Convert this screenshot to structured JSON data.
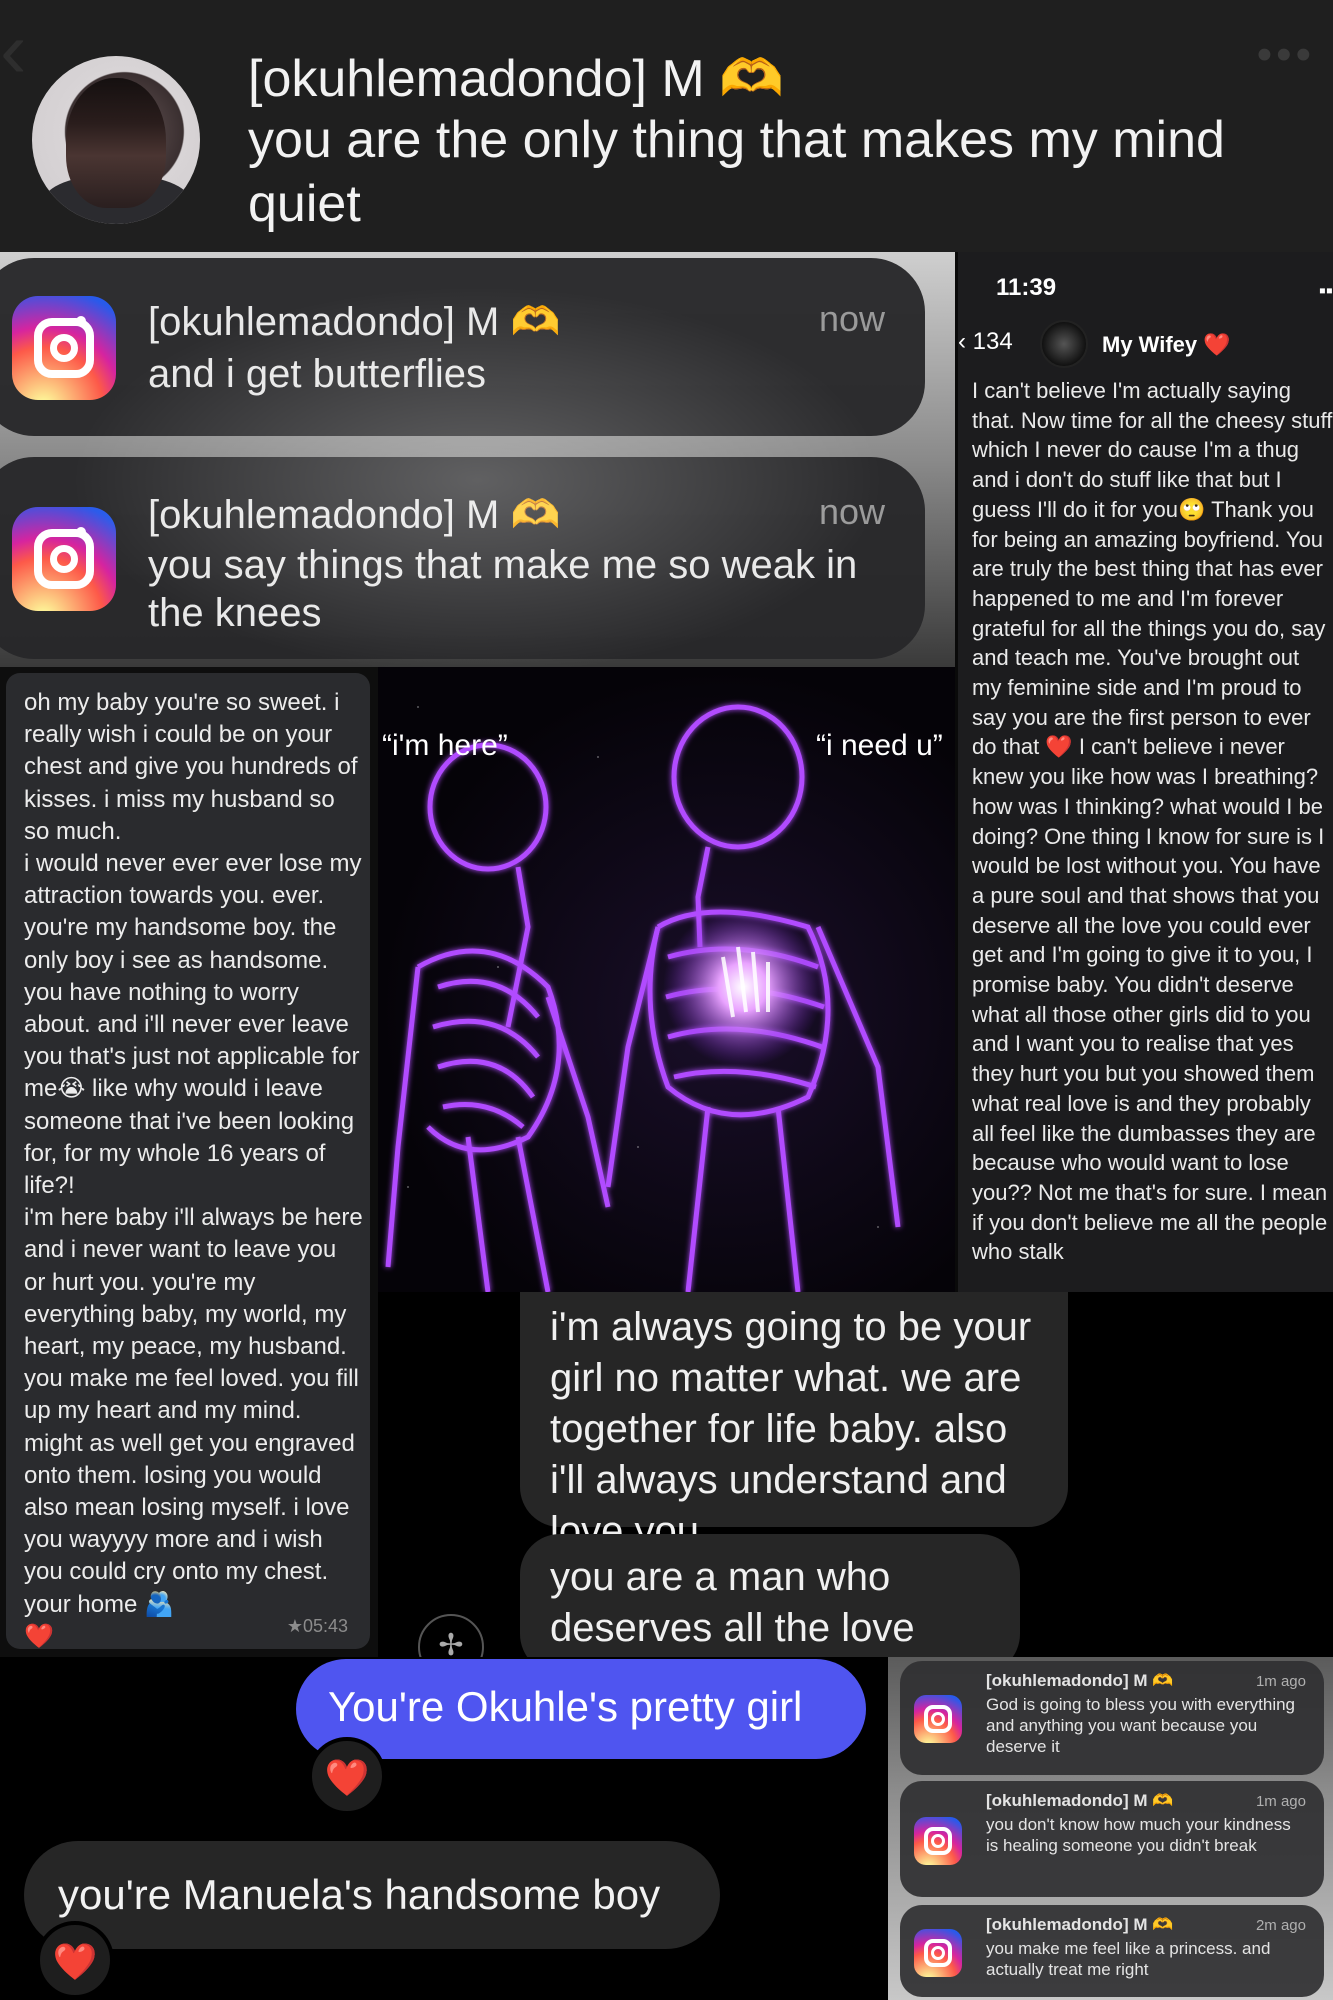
{
  "header": {
    "sender": "[okuhlemadondo] M 🫶",
    "text": "you are the only thing that makes my mind quiet"
  },
  "notifications": [
    {
      "sender": "[okuhlemadondo] M 🫶",
      "time": "now",
      "body": "and i get butterflies"
    },
    {
      "sender": "[okuhlemadondo] M 🫶",
      "time": "now",
      "body": "you say things that make me so weak in the knees"
    }
  ],
  "right_chat": {
    "status_time": "11:39",
    "back_count": "134",
    "contact_name": "My Wifey ❤️",
    "message": "I can't believe I'm actually saying that. Now time for all the cheesy stuff which I never do cause I'm a thug and i don't do stuff like that but I guess I'll do it for you🙄 Thank you for being an amazing boyfriend. You are truly the best thing that has ever happened to me and I'm forever grateful for all the things you do, say and teach me. You've brought out my feminine side and I'm proud to say you are the first person to ever do that ❤️ I can't believe i never knew you like how was I breathing? how was I thinking? what would I be doing? One thing I know for sure is I would be lost without you. You have a pure soul and that shows that you deserve all the love you could ever get and I'm going to give it to you, I promise baby. You didn't deserve what all those other girls did to you and I want you to realise that yes they hurt you but you showed them what real love is and they probably all feel like the dumbasses they are because who would want to lose you?? Not me that's for sure. I mean if you don't believe me all the people who stalk"
  },
  "left_chat": {
    "message": "oh my baby you're so sweet. i really wish i could be on your chest and give you hundreds of kisses. i miss my husband so so much.\ni would never ever ever lose my attraction towards you. ever. you're my handsome boy. the only boy i see as handsome. you have nothing to worry about. and i'll never ever leave you that's just not applicable for me😭 like why would i leave someone that i've been looking for, for my whole 16 years of life?!\ni'm here baby i'll always be here and i never want to leave you or hurt you. you're my everything baby, my world, my heart, my peace, my husband. you make me feel loved. you fill up my heart and my mind. might as well get you engraved onto them. losing you would also mean losing myself. i love you wayyyy more and i wish you could cry onto my chest. your home 🫂\n❤️",
    "timestamp": "★05:43"
  },
  "skeleton_image": {
    "left_caption": "“i'm here”",
    "right_caption": "“i need u”"
  },
  "dark_messages": [
    "i'm always going to be your girl no matter what. we are together for life baby. also i'll always understand and love you",
    "you are a man who deserves all the love and respect"
  ],
  "bottom_messages": {
    "blue": "You're Okuhle's pretty girl",
    "grey": "you're Manuela's handsome boy",
    "reaction": "❤️"
  },
  "small_notifications": [
    {
      "sender": "[okuhlemadondo] M 🫶",
      "time": "1m ago",
      "body": "God is going to bless you with everything and anything you want because you deserve it"
    },
    {
      "sender": "[okuhlemadondo] M 🫶",
      "time": "1m ago",
      "body": "you don't know how much your kindness is healing someone you didn't break"
    },
    {
      "sender": "[okuhlemadondo] M 🫶",
      "time": "2m ago",
      "body": "you make me feel like a princess. and actually treat me right"
    }
  ],
  "colors": {
    "blue_bubble": "#4f55f0",
    "grey_bubble": "#262626",
    "heart": "#ff2e4b",
    "glow": "#b14bff"
  }
}
